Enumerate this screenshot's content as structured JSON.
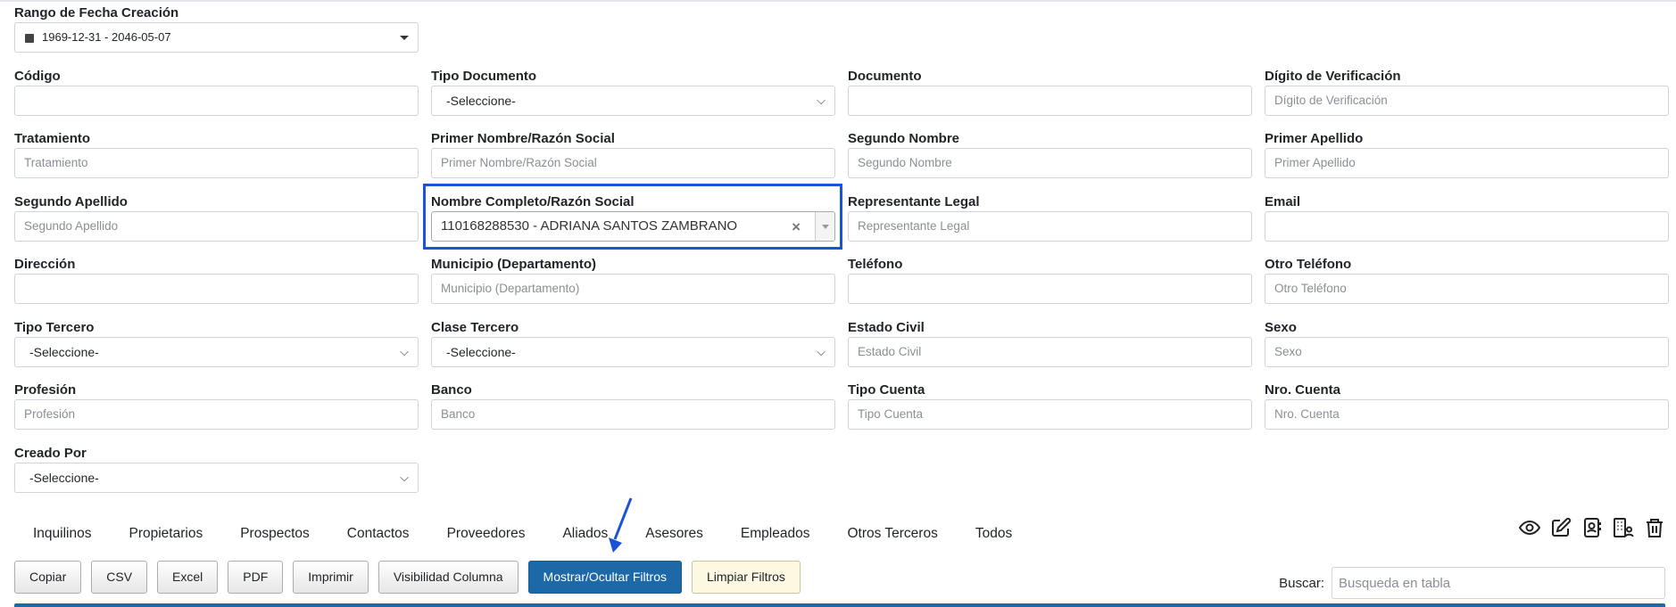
{
  "fecha": {
    "label": "Rango de Fecha Creación",
    "value": "1969-12-31 - 2046-05-07"
  },
  "rows": [
    [
      {
        "label": "Código",
        "kind": "input",
        "value": "",
        "placeholder": ""
      },
      {
        "label": "Tipo Documento",
        "kind": "select",
        "value": "-Seleccione-"
      },
      {
        "label": "Documento",
        "kind": "input",
        "value": "",
        "placeholder": ""
      },
      {
        "label": "Dígito de Verificación",
        "kind": "input",
        "value": "",
        "placeholder": "Dígito de Verificación"
      }
    ],
    [
      {
        "label": "Tratamiento",
        "kind": "input",
        "value": "",
        "placeholder": "Tratamiento"
      },
      {
        "label": "Primer Nombre/Razón Social",
        "kind": "input",
        "value": "",
        "placeholder": "Primer Nombre/Razón Social"
      },
      {
        "label": "Segundo Nombre",
        "kind": "input",
        "value": "",
        "placeholder": "Segundo Nombre"
      },
      {
        "label": "Primer Apellido",
        "kind": "input",
        "value": "",
        "placeholder": "Primer Apellido"
      }
    ],
    [
      {
        "label": "Segundo Apellido",
        "kind": "input",
        "value": "",
        "placeholder": "Segundo Apellido"
      },
      {
        "label": "Nombre Completo/Razón Social",
        "kind": "select2",
        "value": "110168288530 - ADRIANA SANTOS ZAMBRANO"
      },
      {
        "label": "Representante Legal",
        "kind": "input",
        "value": "",
        "placeholder": "Representante Legal"
      },
      {
        "label": "Email",
        "kind": "input",
        "value": "",
        "placeholder": ""
      }
    ],
    [
      {
        "label": "Dirección",
        "kind": "input",
        "value": "",
        "placeholder": ""
      },
      {
        "label": "Municipio (Departamento)",
        "kind": "input",
        "value": "",
        "placeholder": "Municipio (Departamento)"
      },
      {
        "label": "Teléfono",
        "kind": "input",
        "value": "",
        "placeholder": ""
      },
      {
        "label": "Otro Teléfono",
        "kind": "input",
        "value": "",
        "placeholder": "Otro Teléfono"
      }
    ],
    [
      {
        "label": "Tipo Tercero",
        "kind": "select",
        "value": "-Seleccione-"
      },
      {
        "label": "Clase Tercero",
        "kind": "select",
        "value": "-Seleccione-"
      },
      {
        "label": "Estado Civil",
        "kind": "input",
        "value": "",
        "placeholder": "Estado Civil"
      },
      {
        "label": "Sexo",
        "kind": "input",
        "value": "",
        "placeholder": "Sexo"
      }
    ],
    [
      {
        "label": "Profesión",
        "kind": "input",
        "value": "",
        "placeholder": "Profesión"
      },
      {
        "label": "Banco",
        "kind": "input",
        "value": "",
        "placeholder": "Banco"
      },
      {
        "label": "Tipo Cuenta",
        "kind": "input",
        "value": "",
        "placeholder": "Tipo Cuenta"
      },
      {
        "label": "Nro. Cuenta",
        "kind": "input",
        "value": "",
        "placeholder": "Nro. Cuenta"
      }
    ],
    [
      {
        "label": "Creado Por",
        "kind": "select",
        "value": "-Seleccione-"
      }
    ]
  ],
  "tabs": [
    "Inquilinos",
    "Propietarios",
    "Prospectos",
    "Contactos",
    "Proveedores",
    "Aliados",
    "Asesores",
    "Empleados",
    "Otros Terceros",
    "Todos"
  ],
  "actions": [
    "eye-icon",
    "edit-icon",
    "contact-card-icon",
    "building-user-icon",
    "trash-icon"
  ],
  "buttons": [
    {
      "label": "Copiar",
      "style": "default"
    },
    {
      "label": "CSV",
      "style": "default"
    },
    {
      "label": "Excel",
      "style": "default"
    },
    {
      "label": "PDF",
      "style": "default"
    },
    {
      "label": "Imprimir",
      "style": "default"
    },
    {
      "label": "Visibilidad Columna",
      "style": "default"
    },
    {
      "label": "Mostrar/Ocultar Filtros",
      "style": "primary"
    },
    {
      "label": "Limpiar Filtros",
      "style": "warn"
    }
  ],
  "search": {
    "label": "Buscar:",
    "placeholder": "Busqueda en tabla"
  },
  "colors": {
    "highlight": "#1a52d8",
    "primary": "#1d68a7",
    "warn_bg": "#fdf8e1"
  }
}
